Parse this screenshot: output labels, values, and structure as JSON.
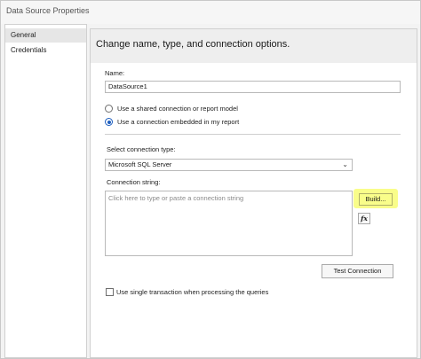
{
  "window": {
    "title": "Data Source Properties"
  },
  "nav": {
    "items": [
      {
        "label": "General",
        "selected": true
      },
      {
        "label": "Credentials",
        "selected": false
      }
    ]
  },
  "main": {
    "heading": "Change name, type, and connection options.",
    "name_label": "Name:",
    "name_value": "DataSource1",
    "radio_shared_label": "Use a shared connection or report model",
    "radio_embedded_label": "Use a connection embedded in my report",
    "selected_radio": "embedded",
    "connection_type_label": "Select connection type:",
    "connection_type_value": "Microsoft SQL Server",
    "connection_string_label": "Connection string:",
    "connection_string_placeholder": "Click here to type or paste a connection string",
    "build_button": "Build...",
    "fx_button": "fx",
    "test_connection_button": "Test Connection",
    "single_transaction_label": "Use single transaction when processing the queries",
    "single_transaction_checked": false
  },
  "colors": {
    "accent": "#1f5fbf",
    "highlight": "#f9fd8a"
  }
}
